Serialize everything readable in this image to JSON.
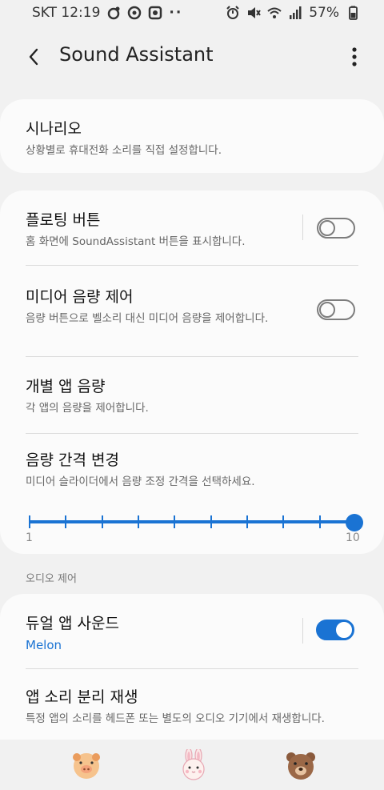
{
  "status_bar": {
    "carrier_time": "SKT 12:19",
    "dots": "··",
    "battery": "57%"
  },
  "header": {
    "title": "Sound Assistant"
  },
  "scenario": {
    "title": "시나리오",
    "subtitle": "상황별로 휴대전화 소리를 직접 설정합니다."
  },
  "floating_button": {
    "title": "플로팅 버튼",
    "subtitle": "홈 화면에 SoundAssistant 버튼을 표시합니다.",
    "enabled": false
  },
  "media_volume": {
    "title": "미디어 음량 제어",
    "subtitle": "음량 버튼으로 벨소리 대신 미디어 음량을 제어합니다.",
    "enabled": false
  },
  "app_volume": {
    "title": "개별 앱 음량",
    "subtitle": "각 앱의 음량을 제어합니다."
  },
  "volume_step": {
    "title": "음량 간격 변경",
    "subtitle": "미디어 슬라이더에서 음량 조정 간격을 선택하세요.",
    "min_label": "1",
    "max_label": "10",
    "value": 10
  },
  "audio_section_label": "오디오 제어",
  "dual_app_sound": {
    "title": "듀얼 앱 사운드",
    "subtitle": "Melon",
    "enabled": true
  },
  "separate_playback": {
    "title": "앱 소리 분리 재생",
    "subtitle": "특정 앱의 소리를 헤드폰 또는 별도의 오디오 기기에서 재생합니다."
  },
  "colors": {
    "accent": "#1a73d3",
    "background": "#f1f1f1",
    "card": "#fbfbfb"
  },
  "bottom_bar": {
    "icons": [
      "pig-icon",
      "bunny-icon",
      "bear-icon"
    ]
  }
}
